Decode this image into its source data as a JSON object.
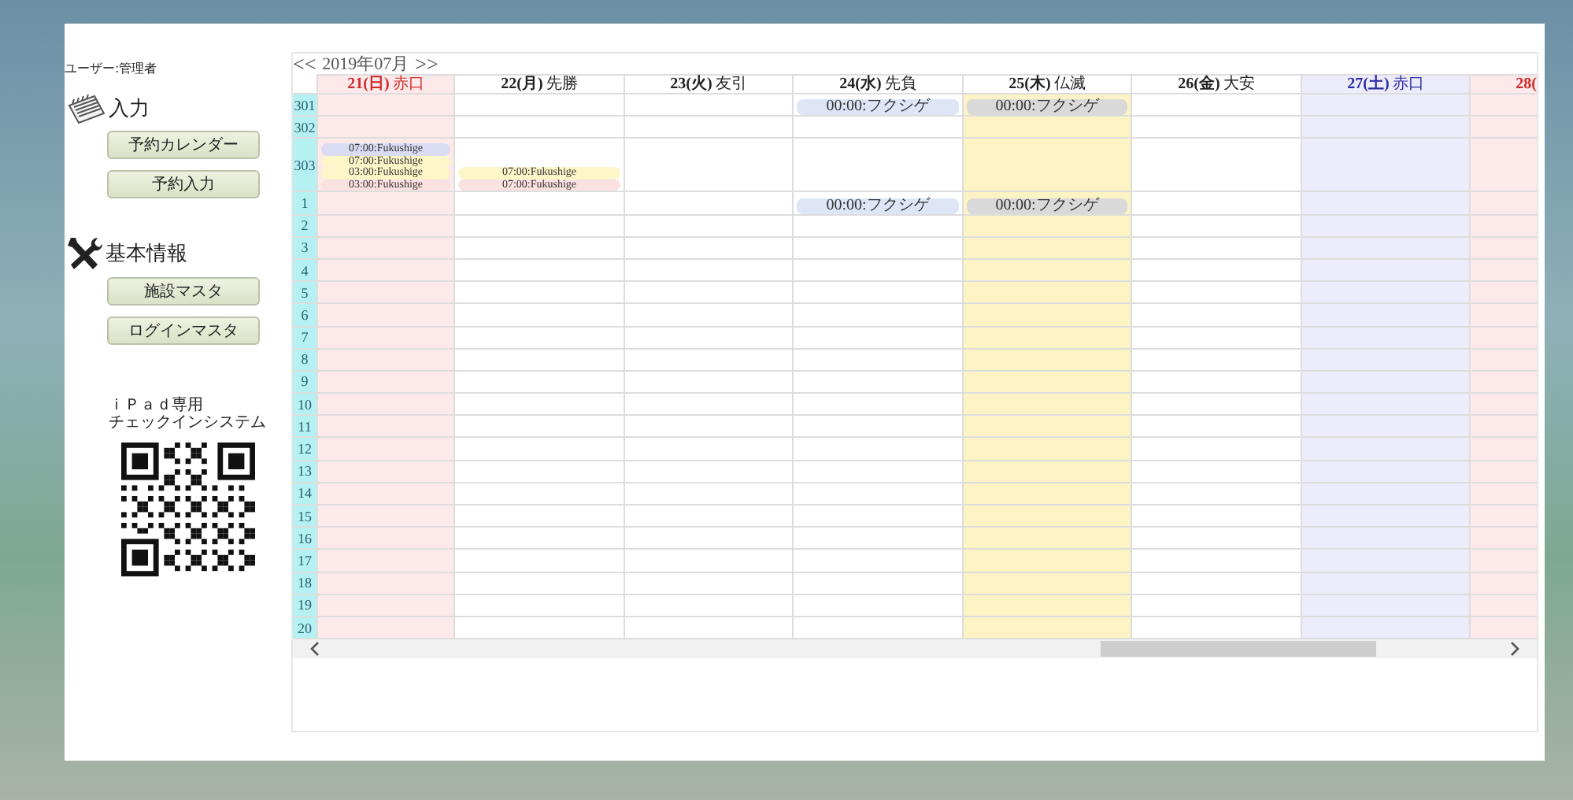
{
  "sidebar": {
    "user": "ユーザー:管理者",
    "sections": [
      {
        "kind": "input",
        "title": "入力",
        "buttons": [
          "予約カレンダー",
          "予約入力"
        ]
      },
      {
        "kind": "master",
        "title": "基本情報",
        "buttons": [
          "施設マスタ",
          "ログインマスタ"
        ]
      }
    ],
    "ipad_caption": [
      "ｉＰａｄ専用",
      "チェックインシステム"
    ]
  },
  "calendar": {
    "prev": "<<",
    "month": "2019年07月",
    "next": ">>",
    "days": [
      {
        "date": "21(日)",
        "rokuyo": "赤口",
        "kind": "sunday",
        "today": false
      },
      {
        "date": "22(月)",
        "rokuyo": "先勝",
        "kind": "weekday",
        "today": false
      },
      {
        "date": "23(火)",
        "rokuyo": "友引",
        "kind": "weekday",
        "today": false
      },
      {
        "date": "24(水)",
        "rokuyo": "先負",
        "kind": "weekday",
        "today": false
      },
      {
        "date": "25(木)",
        "rokuyo": "仏滅",
        "kind": "weekday",
        "today": true
      },
      {
        "date": "26(金)",
        "rokuyo": "大安",
        "kind": "weekday",
        "today": false
      },
      {
        "date": "27(土)",
        "rokuyo": "赤口",
        "kind": "saturday",
        "today": false
      },
      {
        "date": "28(",
        "kind": "sunday",
        "today": false
      }
    ],
    "rows": [
      {
        "label": "301",
        "cells": [
          {},
          {},
          {},
          {
            "events": [
              {
                "text": "00:00:フクシゲ",
                "color": "#dde5f7"
              }
            ]
          },
          {
            "events": [
              {
                "text": "00:00:フクシゲ",
                "color": "#d9d9d9"
              }
            ]
          },
          {},
          {},
          {}
        ]
      },
      {
        "label": "302",
        "cells": [
          {},
          {},
          {},
          {},
          {},
          {},
          {},
          {}
        ]
      },
      {
        "label": "303",
        "cells": [
          {
            "events": [
              {
                "text": "07:00:Fukushige",
                "color": "#d9dcf2"
              },
              {
                "text": "07:00:Fukushige",
                "color": "#fdf6c8"
              },
              {
                "text": "03:00:Fukushige",
                "color": "#fdf6c8"
              },
              {
                "text": "03:00:Fukushige",
                "color": "#fbe1e1"
              }
            ]
          },
          {
            "events": [
              {
                "text": "07:00:Fukushige",
                "color": "#fdf6c8"
              },
              {
                "text": "07:00:Fukushige",
                "color": "#fbe1e1"
              }
            ]
          },
          {},
          {},
          {},
          {},
          {},
          {}
        ]
      },
      {
        "label": "1",
        "cells": [
          {},
          {},
          {},
          {
            "events": [
              {
                "text": "00:00:フクシゲ",
                "color": "#dde5f7"
              }
            ]
          },
          {
            "events": [
              {
                "text": "00:00:フクシゲ",
                "color": "#d9d9d9"
              }
            ]
          },
          {},
          {},
          {}
        ]
      },
      {
        "label": "2",
        "cells": [
          {},
          {},
          {},
          {},
          {},
          {},
          {},
          {}
        ]
      },
      {
        "label": "3",
        "cells": [
          {},
          {},
          {},
          {},
          {},
          {},
          {},
          {}
        ]
      },
      {
        "label": "4",
        "cells": [
          {},
          {},
          {},
          {},
          {},
          {},
          {},
          {}
        ]
      },
      {
        "label": "5",
        "cells": [
          {},
          {},
          {},
          {},
          {},
          {},
          {},
          {}
        ]
      },
      {
        "label": "6",
        "cells": [
          {},
          {},
          {},
          {},
          {},
          {},
          {},
          {}
        ]
      },
      {
        "label": "7",
        "cells": [
          {},
          {},
          {},
          {},
          {},
          {},
          {},
          {}
        ]
      },
      {
        "label": "8",
        "cells": [
          {},
          {},
          {},
          {},
          {},
          {},
          {},
          {}
        ]
      },
      {
        "label": "9",
        "cells": [
          {},
          {},
          {},
          {},
          {},
          {},
          {},
          {}
        ]
      },
      {
        "label": "10",
        "cells": [
          {},
          {},
          {},
          {},
          {},
          {},
          {},
          {}
        ]
      },
      {
        "label": "11",
        "cells": [
          {},
          {},
          {},
          {},
          {},
          {},
          {},
          {}
        ]
      },
      {
        "label": "12",
        "cells": [
          {},
          {},
          {},
          {},
          {},
          {},
          {},
          {}
        ]
      },
      {
        "label": "13",
        "cells": [
          {},
          {},
          {},
          {},
          {},
          {},
          {},
          {}
        ]
      },
      {
        "label": "14",
        "cells": [
          {},
          {},
          {},
          {},
          {},
          {},
          {},
          {}
        ]
      },
      {
        "label": "15",
        "cells": [
          {},
          {},
          {},
          {},
          {},
          {},
          {},
          {}
        ]
      },
      {
        "label": "16",
        "cells": [
          {},
          {},
          {},
          {},
          {},
          {},
          {},
          {}
        ]
      },
      {
        "label": "17",
        "cells": [
          {},
          {},
          {},
          {},
          {},
          {},
          {},
          {}
        ]
      },
      {
        "label": "18",
        "cells": [
          {},
          {},
          {},
          {},
          {},
          {},
          {},
          {}
        ]
      },
      {
        "label": "19",
        "cells": [
          {},
          {},
          {},
          {},
          {},
          {},
          {},
          {}
        ]
      },
      {
        "label": "20",
        "cells": [
          {},
          {},
          {},
          {},
          {},
          {},
          {},
          {}
        ]
      }
    ]
  }
}
